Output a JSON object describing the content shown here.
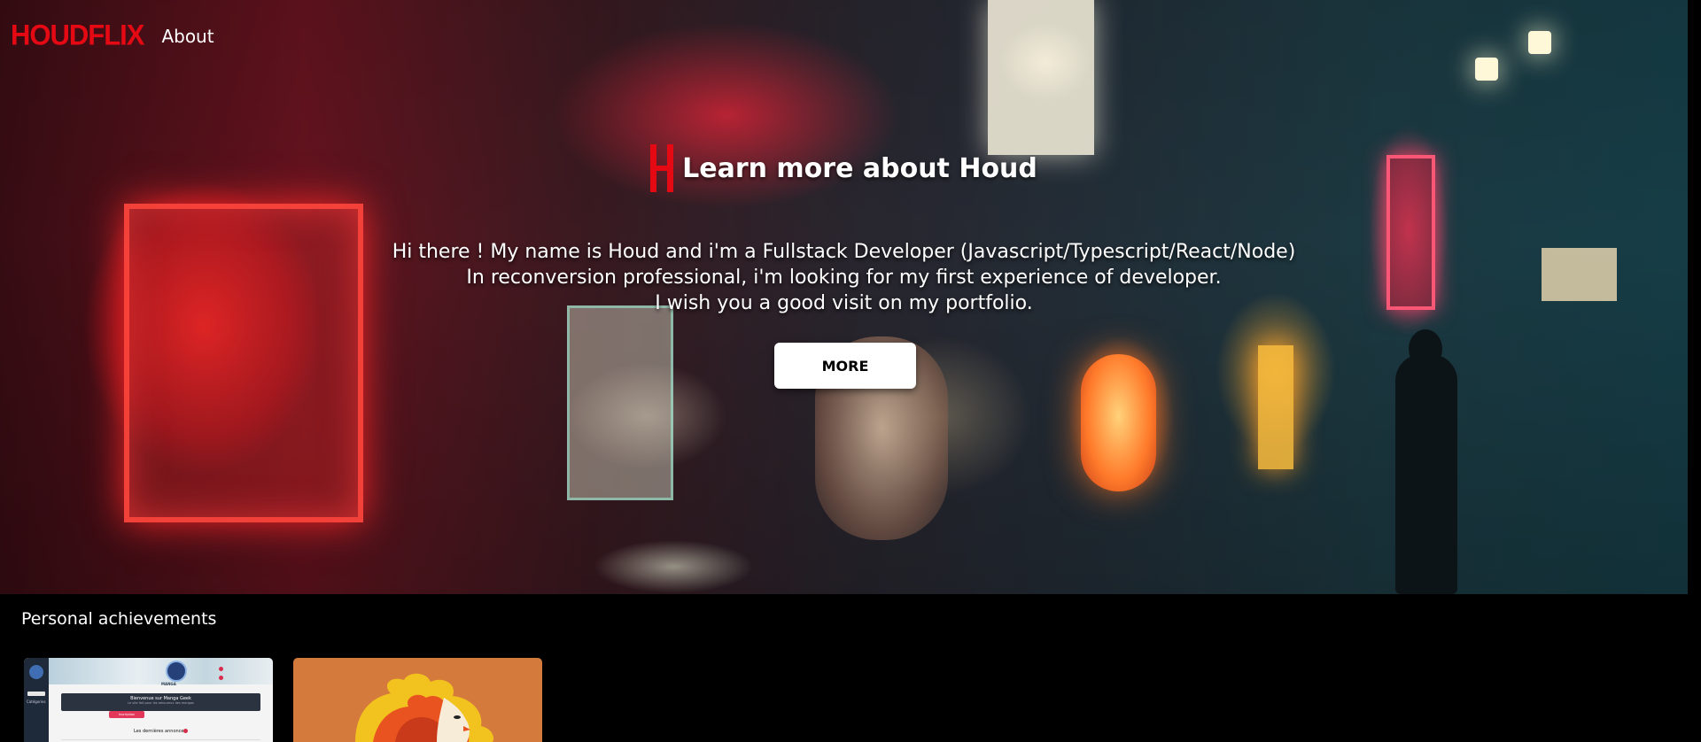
{
  "header": {
    "logo": "HOUDFLIX",
    "nav_about": "About"
  },
  "hero": {
    "title": "Learn more about Houd",
    "description_lines": [
      "Hi there ! My name is Houd and i'm a Fullstack Developer (Javascript/Typescript/React/Node)",
      "In reconversion professional, i'm looking for my first experience of developer.",
      "I wish you a good visit on my portfolio."
    ],
    "button_label": "MORE"
  },
  "achievements": {
    "title": "Personal achievements",
    "cards": [
      {
        "sidebar_label": "Catégories",
        "emblem_label": "MANGA",
        "banner_title": "Bienvenue sur Manga Geek",
        "banner_subtitle": "Le site fait pour les amoureux des mangas",
        "cta_label": "Inscription",
        "latest_label": "Les dernières annonces"
      },
      {}
    ]
  },
  "colors": {
    "brand_red": "#e50914",
    "background": "#000000",
    "button_bg": "#ffffff",
    "card_orange": "#d47a3c"
  }
}
